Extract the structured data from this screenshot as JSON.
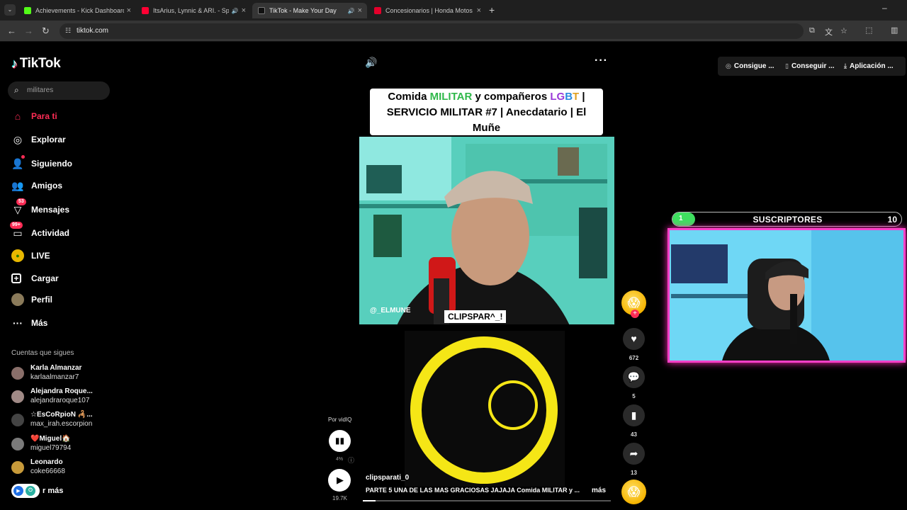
{
  "browser": {
    "tabs": [
      {
        "title": "Achievements - Kick Dashboard",
        "icon": "kick-favicon",
        "color": "#53fc18"
      },
      {
        "title": "ItsArius, Lynnic & ARI. - Spe",
        "icon": "youtube-favicon",
        "color": "#ff0033",
        "audio": true
      },
      {
        "title": "TikTok - Make Your Day",
        "icon": "tiktok-favicon",
        "color": "#111111",
        "audio": true,
        "active": true
      },
      {
        "title": "Concesionarios | Honda Motos",
        "icon": "honda-favicon",
        "color": "#e4002b"
      }
    ],
    "url": "tiktok.com"
  },
  "sidebar": {
    "logo": "TikTok",
    "search_placeholder": "militares",
    "nav": [
      {
        "label": "Para ti",
        "icon": "home-icon",
        "active": true
      },
      {
        "label": "Explorar",
        "icon": "compass-icon"
      },
      {
        "label": "Siguiendo",
        "icon": "following-icon"
      },
      {
        "label": "Amigos",
        "icon": "friends-icon"
      },
      {
        "label": "Mensajes",
        "icon": "messages-icon",
        "badge": "53"
      },
      {
        "label": "Actividad",
        "icon": "activity-icon",
        "badge": "99+"
      },
      {
        "label": "LIVE",
        "icon": "live-icon"
      },
      {
        "label": "Cargar",
        "icon": "upload-icon"
      },
      {
        "label": "Perfil",
        "icon": "profile-icon"
      },
      {
        "label": "Más",
        "icon": "more-icon"
      }
    ],
    "following_header": "Cuentas que sigues",
    "following": [
      {
        "name": "Karla Almanzar",
        "handle": "karlaalmanzar7"
      },
      {
        "name": "Alejandra Roque...",
        "handle": "alejandraroque107"
      },
      {
        "name": "☆EsCoRpioN 🦂...",
        "handle": "max_irah.escorpion"
      },
      {
        "name": "❤️Miguel🏠",
        "handle": "miguel79794"
      },
      {
        "name": "Leonardo",
        "handle": "coke66668"
      }
    ],
    "see_more": "r más"
  },
  "video": {
    "title_lines": [
      "Comida MILITAR y compañeros LGBT |",
      "SERVICIO MILITAR #7 | Anecdatario | El",
      "Muñe"
    ],
    "watermark_handle": "@_ELMUNE",
    "clip_label": "CLIPSPAR^_!",
    "vidiq_label": "Por vidIQ",
    "vidiq_percent": "4%",
    "views": "19.7K",
    "author": "clipsparati_0",
    "caption": "PARTE 5 UNA DE LAS MAS GRACIOSAS JAJAJA Comida MILITAR y ...",
    "caption_more": "más",
    "progress": 0.05
  },
  "actions": {
    "likes": "672",
    "comments": "5",
    "saves": "43",
    "shares": "13"
  },
  "topright": {
    "coins": "Consigue ...",
    "app": "Conseguir ...",
    "download": "Aplicación ..."
  },
  "overlay": {
    "sub_current": "1",
    "sub_label": "SUSCRIPTORES",
    "sub_goal": "10",
    "sub_progress": 0.1
  }
}
